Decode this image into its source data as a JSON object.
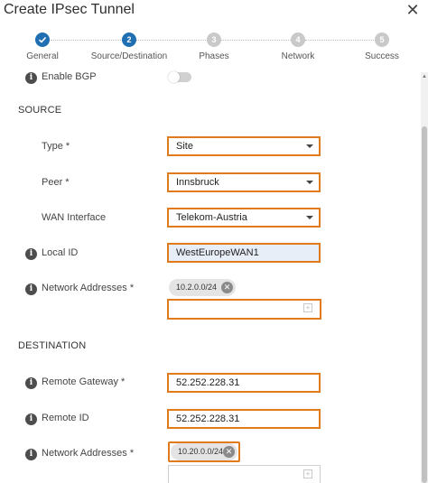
{
  "dialog": {
    "title": "Create IPsec Tunnel"
  },
  "stepper": {
    "steps": [
      {
        "number": "",
        "label": "General",
        "state": "done"
      },
      {
        "number": "2",
        "label": "Source/Destination",
        "state": "active"
      },
      {
        "number": "3",
        "label": "Phases",
        "state": "todo"
      },
      {
        "number": "4",
        "label": "Network",
        "state": "todo"
      },
      {
        "number": "5",
        "label": "Success",
        "state": "todo"
      }
    ]
  },
  "bgp": {
    "label": "Enable BGP",
    "enabled": false
  },
  "source": {
    "heading": "SOURCE",
    "type": {
      "label": "Type *",
      "value": "Site"
    },
    "peer": {
      "label": "Peer *",
      "value": "Innsbruck"
    },
    "wan": {
      "label": "WAN Interface",
      "value": "Telekom-Austria"
    },
    "local_id": {
      "label": "Local ID",
      "value": "WestEuropeWAN1"
    },
    "network": {
      "label": "Network Addresses *",
      "chip": "10.2.0.0/24",
      "input_value": ""
    }
  },
  "destination": {
    "heading": "DESTINATION",
    "remote_gateway": {
      "label": "Remote Gateway *",
      "value": "52.252.228.31"
    },
    "remote_id": {
      "label": "Remote ID",
      "value": "52.252.228.31"
    },
    "network": {
      "label": "Network Addresses *",
      "chip": "10.20.0.0/24",
      "input_value": ""
    }
  },
  "colors": {
    "accent": "#1f6fb2",
    "highlight": "#e07b1d",
    "step_todo": "#c9c9c9"
  },
  "icons": {
    "close": "close-icon",
    "info": "info-icon",
    "check": "check-icon",
    "caret": "chevron-down-icon",
    "add": "plus-icon",
    "remove": "remove-chip-icon"
  }
}
